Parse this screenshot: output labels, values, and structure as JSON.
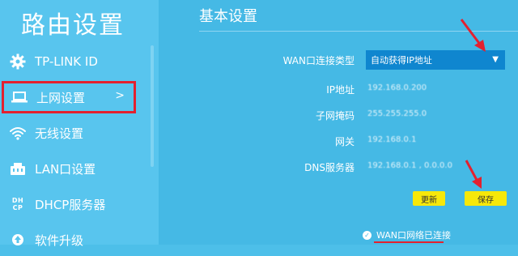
{
  "sidebar": {
    "title": "路由设置",
    "items": [
      {
        "label": "TP-LINK ID",
        "icon": "gear-icon"
      },
      {
        "label": "上网设置",
        "icon": "laptop-icon",
        "arrow": ">",
        "active": true
      },
      {
        "label": "无线设置",
        "icon": "wifi-icon"
      },
      {
        "label": "LAN口设置",
        "icon": "lan-icon"
      },
      {
        "label": "DHCP服务器",
        "icon": "dhcp-icon",
        "icon_text": "DH\nCP"
      },
      {
        "label": "软件升级",
        "icon": "upgrade-icon"
      }
    ]
  },
  "main": {
    "section_title": "基本设置",
    "wan_type": {
      "label": "WAN口连接类型",
      "value": "自动获得IP地址"
    },
    "ip": {
      "label": "IP地址",
      "value": "192.168.0.200"
    },
    "mask": {
      "label": "子网掩码",
      "value": "255.255.255.0"
    },
    "gateway": {
      "label": "网关",
      "value": "192.168.0.1"
    },
    "dns": {
      "label": "DNS服务器",
      "value": "192.168.0.1 , 0.0.0.0"
    },
    "refresh_label": "更新",
    "save_label": "保存",
    "status_text": "WAN口网络已连接"
  },
  "colors": {
    "background": "#4dbfe9",
    "select_bg": "#0f86cf",
    "button_bg": "#f7e80a",
    "highlight": "#e3212f"
  }
}
